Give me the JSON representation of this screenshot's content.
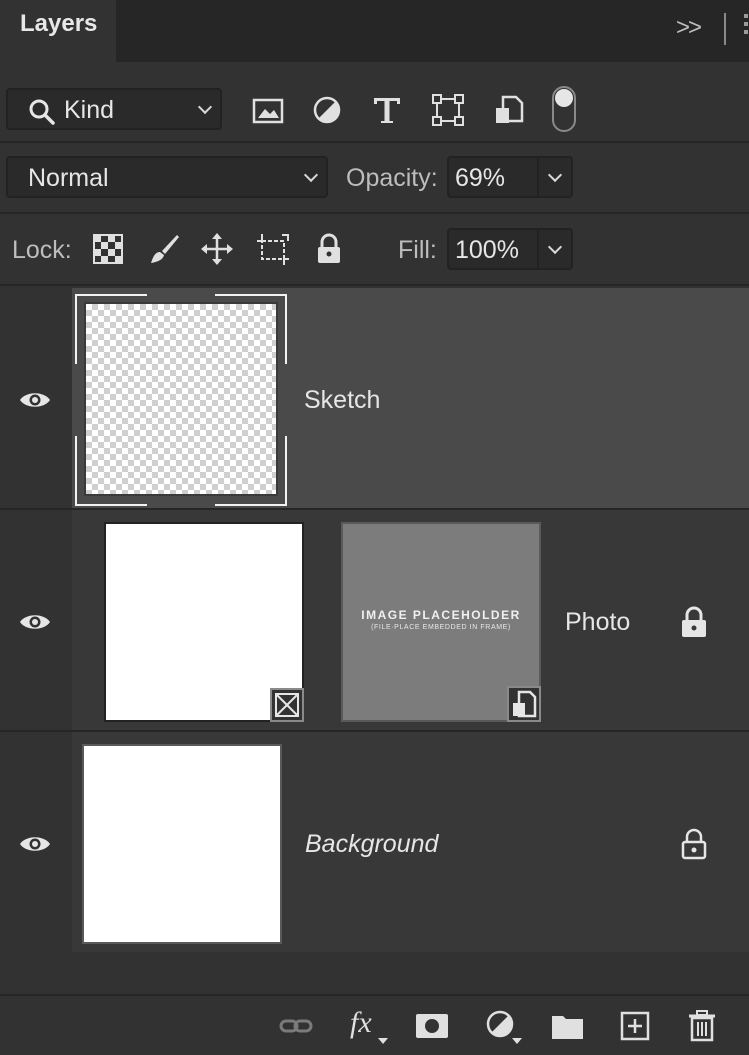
{
  "panel": {
    "tab_title": "Layers",
    "collapse_label": ">>"
  },
  "filter": {
    "kind_label": "Kind",
    "icons": [
      "image-filter-icon",
      "adjustment-filter-icon",
      "type-filter-icon",
      "shape-filter-icon",
      "smart-object-filter-icon"
    ],
    "filter_toggle_on": true
  },
  "blend": {
    "mode": "Normal",
    "opacity_label": "Opacity:",
    "opacity_value": "69%"
  },
  "lock": {
    "label": "Lock:",
    "icons": [
      "lock-transparent-pixels-icon",
      "lock-image-pixels-icon",
      "lock-position-icon",
      "lock-artboard-icon",
      "lock-all-icon"
    ],
    "fill_label": "Fill:",
    "fill_value": "100%"
  },
  "layers": [
    {
      "name": "Sketch",
      "visible": true,
      "selected": true,
      "thumbnail": "transparent",
      "locked": false
    },
    {
      "name": "Photo",
      "visible": true,
      "selected": false,
      "thumbnail": "frame",
      "placeholder_title": "IMAGE PLACEHOLDER",
      "placeholder_subtitle": "(FILE·PLACE EMBEDDED IN FRAME)",
      "locked": true
    },
    {
      "name": "Background",
      "visible": true,
      "selected": false,
      "thumbnail": "white",
      "locked": true,
      "italic": true
    }
  ],
  "footer_icons": [
    "link-layers-icon",
    "fx-icon",
    "add-mask-icon",
    "adjustment-layer-icon",
    "new-group-icon",
    "new-layer-icon",
    "delete-icon"
  ],
  "footer": {
    "fx_label": "fx"
  },
  "colors": {
    "panel": "#323232",
    "selected_row": "#4a4a4a",
    "row": "#383838",
    "tab_bar": "#262626"
  }
}
